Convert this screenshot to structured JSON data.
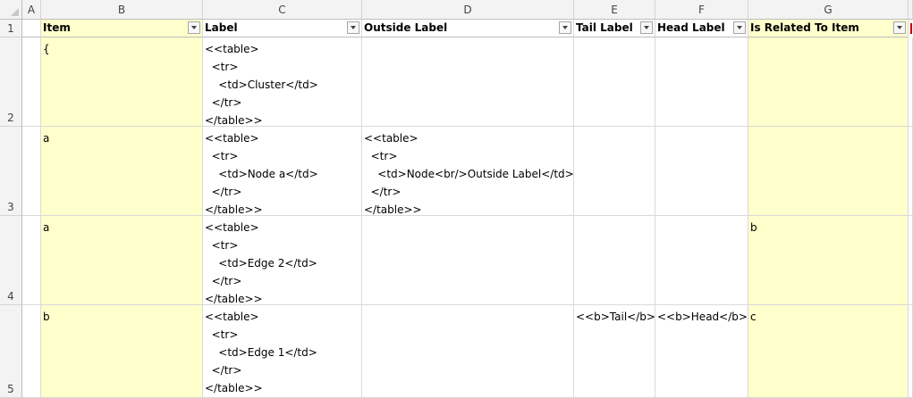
{
  "columns": [
    "A",
    "B",
    "C",
    "D",
    "E",
    "F",
    "G"
  ],
  "rows": [
    "1",
    "2",
    "3",
    "4",
    "5"
  ],
  "headers": {
    "item": "Item",
    "label": "Label",
    "outside_label": "Outside Label",
    "tail_label": "Tail Label",
    "head_label": "Head Label",
    "related": "Is Related To Item"
  },
  "data_rows": [
    {
      "item": "{",
      "label": "<<table>\n  <tr>\n    <td>Cluster</td>\n  </tr>\n</table>>",
      "outside_label": "",
      "tail_label": "",
      "head_label": "",
      "related": ""
    },
    {
      "item": "a",
      "label": "<<table>\n  <tr>\n    <td>Node a</td>\n  </tr>\n</table>>",
      "outside_label": "<<table>\n  <tr>\n    <td>Node<br/>Outside Label</td>\n  </tr>\n</table>>",
      "tail_label": "",
      "head_label": "",
      "related": ""
    },
    {
      "item": "a",
      "label": "<<table>\n  <tr>\n    <td>Edge 2</td>\n  </tr>\n</table>>",
      "outside_label": "",
      "tail_label": "",
      "head_label": "",
      "related": "b"
    },
    {
      "item": "b",
      "label": "<<table>\n  <tr>\n    <td>Edge 1</td>\n  </tr>\n</table>>",
      "outside_label": "",
      "tail_label": "<<b>Tail</b>>",
      "head_label": "<<b>Head</b>>",
      "related": "c"
    }
  ],
  "colors": {
    "table_fill": "#ffffcc",
    "header_bg": "#f3f3f3"
  }
}
